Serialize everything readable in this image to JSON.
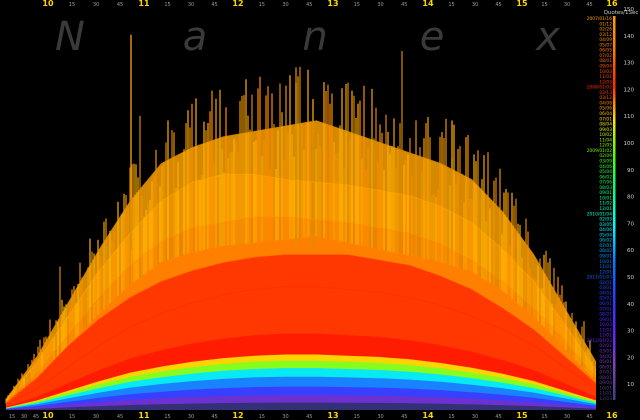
{
  "watermark": [
    "N",
    "a",
    "n",
    "e",
    "x"
  ],
  "chart_data": {
    "type": "line",
    "title": "",
    "ylabel": "Quotes/1Sec",
    "ylim": [
      0,
      150
    ],
    "y_ticks": [
      10,
      20,
      30,
      40,
      50,
      60,
      70,
      80,
      90,
      100,
      110,
      120,
      130,
      140,
      150
    ],
    "x_hour_labels": [
      "10",
      "11",
      "12",
      "13",
      "14",
      "15",
      "16"
    ],
    "x_minute_labels": [
      "15",
      "30",
      "45"
    ],
    "grid": false,
    "legend_position": "right",
    "legend_labels": [
      "2007/01/16",
      "01/12",
      "02/26",
      "03/12",
      "04/09",
      "05/07",
      "06/05",
      "07/02",
      "08/01",
      "09/04",
      "10/03",
      "11/01",
      "12/03",
      "2008/01/02",
      "02/13",
      "03/12",
      "04/08",
      "05/06",
      "06/04",
      "07/01",
      "08/04",
      "09/03",
      "10/02",
      "11/04",
      "12/05",
      "2009/01/02",
      "02/09",
      "03/09",
      "04/06",
      "05/04",
      "06/02",
      "07/06",
      "08/03",
      "09/01",
      "10/01",
      "11/02",
      "12/01",
      "2010/01/04",
      "02/03",
      "03/05",
      "04/06",
      "05/04",
      "06/02",
      "07/01",
      "08/02",
      "09/01",
      "10/01",
      "11/01",
      "12/01",
      "2011/01/03",
      "02/01",
      "03/01",
      "04/01",
      "05/02",
      "06/01",
      "07/01",
      "08/01",
      "09/01",
      "10/03",
      "11/01",
      "12/01",
      "2012/01/03",
      "02/01",
      "03/01",
      "04/02",
      "05/01",
      "06/01",
      "07/02",
      "08/01",
      "09/04",
      "10/01",
      "11/01",
      "12/03"
    ],
    "color_scale": [
      "#ffa000",
      "#ff7a00",
      "#ff2a00",
      "#ffe600",
      "#50ff00",
      "#00ff80",
      "#00ffff",
      "#0080ff",
      "#2040ff",
      "#6020ff",
      "#8040c0",
      "#404080"
    ],
    "series": [
      {
        "values": [
          2,
          8,
          16,
          24,
          31,
          36,
          40,
          43,
          45,
          46,
          46,
          45,
          44,
          42,
          39,
          35,
          30,
          24,
          16,
          8
        ]
      },
      {
        "values": [
          3,
          12,
          24,
          34,
          42,
          48,
          52,
          55,
          57,
          58,
          58,
          58,
          56,
          54,
          50,
          45,
          38,
          30,
          20,
          10
        ]
      },
      {
        "values": [
          3,
          14,
          28,
          42,
          54,
          63,
          68,
          70,
          72,
          72,
          71,
          70,
          68,
          66,
          62,
          56,
          48,
          38,
          26,
          12
        ]
      },
      {
        "values": [
          4,
          18,
          35,
          52,
          66,
          78,
          85,
          88,
          88,
          86,
          85,
          84,
          82,
          80,
          76,
          70,
          60,
          48,
          32,
          15
        ]
      },
      {
        "values": [
          4,
          20,
          40,
          60,
          78,
          92,
          98,
          102,
          104,
          106,
          108,
          104,
          100,
          96,
          92,
          86,
          74,
          58,
          38,
          18
        ]
      }
    ]
  }
}
